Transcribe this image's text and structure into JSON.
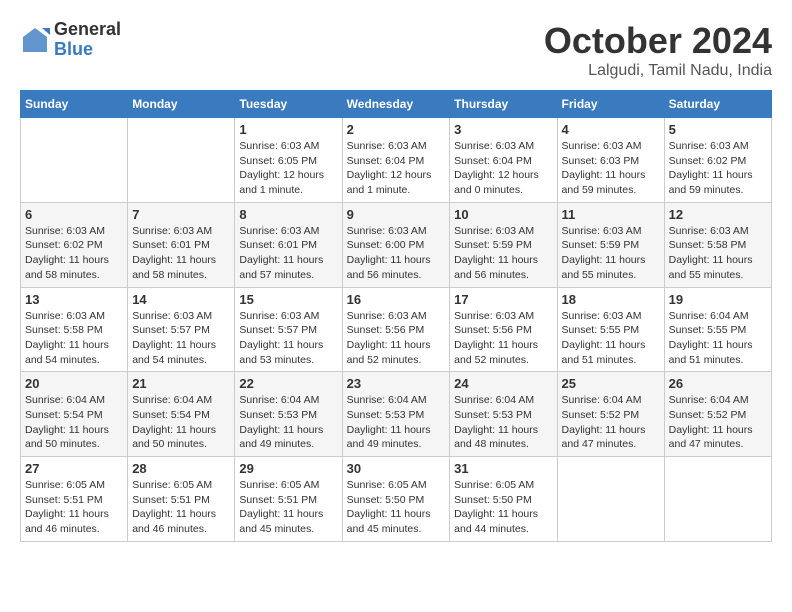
{
  "logo": {
    "general": "General",
    "blue": "Blue"
  },
  "title": "October 2024",
  "location": "Lalgudi, Tamil Nadu, India",
  "days_of_week": [
    "Sunday",
    "Monday",
    "Tuesday",
    "Wednesday",
    "Thursday",
    "Friday",
    "Saturday"
  ],
  "weeks": [
    [
      {
        "day": "",
        "info": ""
      },
      {
        "day": "",
        "info": ""
      },
      {
        "day": "1",
        "info": "Sunrise: 6:03 AM\nSunset: 6:05 PM\nDaylight: 12 hours and 1 minute."
      },
      {
        "day": "2",
        "info": "Sunrise: 6:03 AM\nSunset: 6:04 PM\nDaylight: 12 hours and 1 minute."
      },
      {
        "day": "3",
        "info": "Sunrise: 6:03 AM\nSunset: 6:04 PM\nDaylight: 12 hours and 0 minutes."
      },
      {
        "day": "4",
        "info": "Sunrise: 6:03 AM\nSunset: 6:03 PM\nDaylight: 11 hours and 59 minutes."
      },
      {
        "day": "5",
        "info": "Sunrise: 6:03 AM\nSunset: 6:02 PM\nDaylight: 11 hours and 59 minutes."
      }
    ],
    [
      {
        "day": "6",
        "info": "Sunrise: 6:03 AM\nSunset: 6:02 PM\nDaylight: 11 hours and 58 minutes."
      },
      {
        "day": "7",
        "info": "Sunrise: 6:03 AM\nSunset: 6:01 PM\nDaylight: 11 hours and 58 minutes."
      },
      {
        "day": "8",
        "info": "Sunrise: 6:03 AM\nSunset: 6:01 PM\nDaylight: 11 hours and 57 minutes."
      },
      {
        "day": "9",
        "info": "Sunrise: 6:03 AM\nSunset: 6:00 PM\nDaylight: 11 hours and 56 minutes."
      },
      {
        "day": "10",
        "info": "Sunrise: 6:03 AM\nSunset: 5:59 PM\nDaylight: 11 hours and 56 minutes."
      },
      {
        "day": "11",
        "info": "Sunrise: 6:03 AM\nSunset: 5:59 PM\nDaylight: 11 hours and 55 minutes."
      },
      {
        "day": "12",
        "info": "Sunrise: 6:03 AM\nSunset: 5:58 PM\nDaylight: 11 hours and 55 minutes."
      }
    ],
    [
      {
        "day": "13",
        "info": "Sunrise: 6:03 AM\nSunset: 5:58 PM\nDaylight: 11 hours and 54 minutes."
      },
      {
        "day": "14",
        "info": "Sunrise: 6:03 AM\nSunset: 5:57 PM\nDaylight: 11 hours and 54 minutes."
      },
      {
        "day": "15",
        "info": "Sunrise: 6:03 AM\nSunset: 5:57 PM\nDaylight: 11 hours and 53 minutes."
      },
      {
        "day": "16",
        "info": "Sunrise: 6:03 AM\nSunset: 5:56 PM\nDaylight: 11 hours and 52 minutes."
      },
      {
        "day": "17",
        "info": "Sunrise: 6:03 AM\nSunset: 5:56 PM\nDaylight: 11 hours and 52 minutes."
      },
      {
        "day": "18",
        "info": "Sunrise: 6:03 AM\nSunset: 5:55 PM\nDaylight: 11 hours and 51 minutes."
      },
      {
        "day": "19",
        "info": "Sunrise: 6:04 AM\nSunset: 5:55 PM\nDaylight: 11 hours and 51 minutes."
      }
    ],
    [
      {
        "day": "20",
        "info": "Sunrise: 6:04 AM\nSunset: 5:54 PM\nDaylight: 11 hours and 50 minutes."
      },
      {
        "day": "21",
        "info": "Sunrise: 6:04 AM\nSunset: 5:54 PM\nDaylight: 11 hours and 50 minutes."
      },
      {
        "day": "22",
        "info": "Sunrise: 6:04 AM\nSunset: 5:53 PM\nDaylight: 11 hours and 49 minutes."
      },
      {
        "day": "23",
        "info": "Sunrise: 6:04 AM\nSunset: 5:53 PM\nDaylight: 11 hours and 49 minutes."
      },
      {
        "day": "24",
        "info": "Sunrise: 6:04 AM\nSunset: 5:53 PM\nDaylight: 11 hours and 48 minutes."
      },
      {
        "day": "25",
        "info": "Sunrise: 6:04 AM\nSunset: 5:52 PM\nDaylight: 11 hours and 47 minutes."
      },
      {
        "day": "26",
        "info": "Sunrise: 6:04 AM\nSunset: 5:52 PM\nDaylight: 11 hours and 47 minutes."
      }
    ],
    [
      {
        "day": "27",
        "info": "Sunrise: 6:05 AM\nSunset: 5:51 PM\nDaylight: 11 hours and 46 minutes."
      },
      {
        "day": "28",
        "info": "Sunrise: 6:05 AM\nSunset: 5:51 PM\nDaylight: 11 hours and 46 minutes."
      },
      {
        "day": "29",
        "info": "Sunrise: 6:05 AM\nSunset: 5:51 PM\nDaylight: 11 hours and 45 minutes."
      },
      {
        "day": "30",
        "info": "Sunrise: 6:05 AM\nSunset: 5:50 PM\nDaylight: 11 hours and 45 minutes."
      },
      {
        "day": "31",
        "info": "Sunrise: 6:05 AM\nSunset: 5:50 PM\nDaylight: 11 hours and 44 minutes."
      },
      {
        "day": "",
        "info": ""
      },
      {
        "day": "",
        "info": ""
      }
    ]
  ]
}
